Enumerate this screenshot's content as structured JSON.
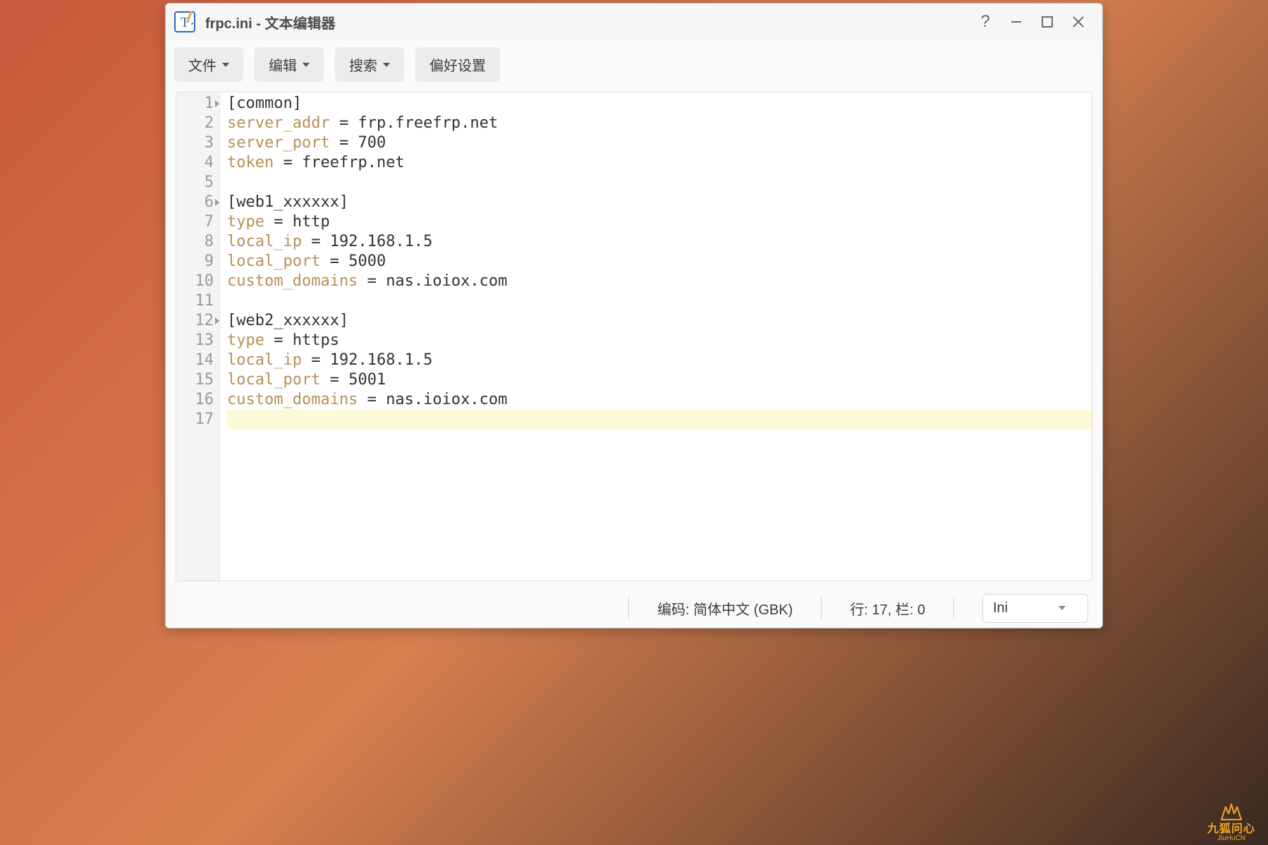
{
  "window": {
    "title": "frpc.ini - 文本编辑器"
  },
  "toolbar": {
    "file": "文件",
    "edit": "编辑",
    "search": "搜索",
    "prefs": "偏好设置"
  },
  "editor": {
    "active_line": 17,
    "lines": [
      {
        "n": 1,
        "fold": true,
        "tokens": [
          {
            "t": "section",
            "v": "[common]"
          }
        ]
      },
      {
        "n": 2,
        "fold": false,
        "tokens": [
          {
            "t": "key",
            "v": "server_addr"
          },
          {
            "t": "op",
            "v": " = "
          },
          {
            "t": "val",
            "v": "frp.freefrp.net"
          }
        ]
      },
      {
        "n": 3,
        "fold": false,
        "tokens": [
          {
            "t": "key",
            "v": "server_port"
          },
          {
            "t": "op",
            "v": " = "
          },
          {
            "t": "val",
            "v": "700"
          }
        ]
      },
      {
        "n": 4,
        "fold": false,
        "tokens": [
          {
            "t": "key",
            "v": "token"
          },
          {
            "t": "op",
            "v": " = "
          },
          {
            "t": "val",
            "v": "freefrp.net"
          }
        ]
      },
      {
        "n": 5,
        "fold": false,
        "tokens": []
      },
      {
        "n": 6,
        "fold": true,
        "tokens": [
          {
            "t": "section",
            "v": "[web1_xxxxxx]"
          }
        ]
      },
      {
        "n": 7,
        "fold": false,
        "tokens": [
          {
            "t": "key",
            "v": "type"
          },
          {
            "t": "op",
            "v": " = "
          },
          {
            "t": "val",
            "v": "http"
          }
        ]
      },
      {
        "n": 8,
        "fold": false,
        "tokens": [
          {
            "t": "key",
            "v": "local_ip"
          },
          {
            "t": "op",
            "v": " = "
          },
          {
            "t": "val",
            "v": "192.168.1.5"
          }
        ]
      },
      {
        "n": 9,
        "fold": false,
        "tokens": [
          {
            "t": "key",
            "v": "local_port"
          },
          {
            "t": "op",
            "v": " = "
          },
          {
            "t": "val",
            "v": "5000"
          }
        ]
      },
      {
        "n": 10,
        "fold": false,
        "tokens": [
          {
            "t": "key",
            "v": "custom_domains"
          },
          {
            "t": "op",
            "v": " = "
          },
          {
            "t": "val",
            "v": "nas.ioiox.com"
          }
        ]
      },
      {
        "n": 11,
        "fold": false,
        "tokens": []
      },
      {
        "n": 12,
        "fold": true,
        "tokens": [
          {
            "t": "section",
            "v": "[web2_xxxxxx]"
          }
        ]
      },
      {
        "n": 13,
        "fold": false,
        "tokens": [
          {
            "t": "key",
            "v": "type"
          },
          {
            "t": "op",
            "v": " = "
          },
          {
            "t": "val",
            "v": "https"
          }
        ]
      },
      {
        "n": 14,
        "fold": false,
        "tokens": [
          {
            "t": "key",
            "v": "local_ip"
          },
          {
            "t": "op",
            "v": " = "
          },
          {
            "t": "val",
            "v": "192.168.1.5"
          }
        ]
      },
      {
        "n": 15,
        "fold": false,
        "tokens": [
          {
            "t": "key",
            "v": "local_port"
          },
          {
            "t": "op",
            "v": " = "
          },
          {
            "t": "val",
            "v": "5001"
          }
        ]
      },
      {
        "n": 16,
        "fold": false,
        "tokens": [
          {
            "t": "key",
            "v": "custom_domains"
          },
          {
            "t": "op",
            "v": " = "
          },
          {
            "t": "val",
            "v": "nas.ioiox.com"
          }
        ]
      },
      {
        "n": 17,
        "fold": false,
        "tokens": []
      }
    ]
  },
  "status": {
    "encoding_label": "编码: ",
    "encoding_value": "简体中文 (GBK)",
    "position_label": "行: ",
    "position_row": "17",
    "position_sep": ", 栏: ",
    "position_col": "0",
    "language": "Ini"
  },
  "watermark": {
    "cn": "九狐问心",
    "en": "JiuHuCN"
  }
}
